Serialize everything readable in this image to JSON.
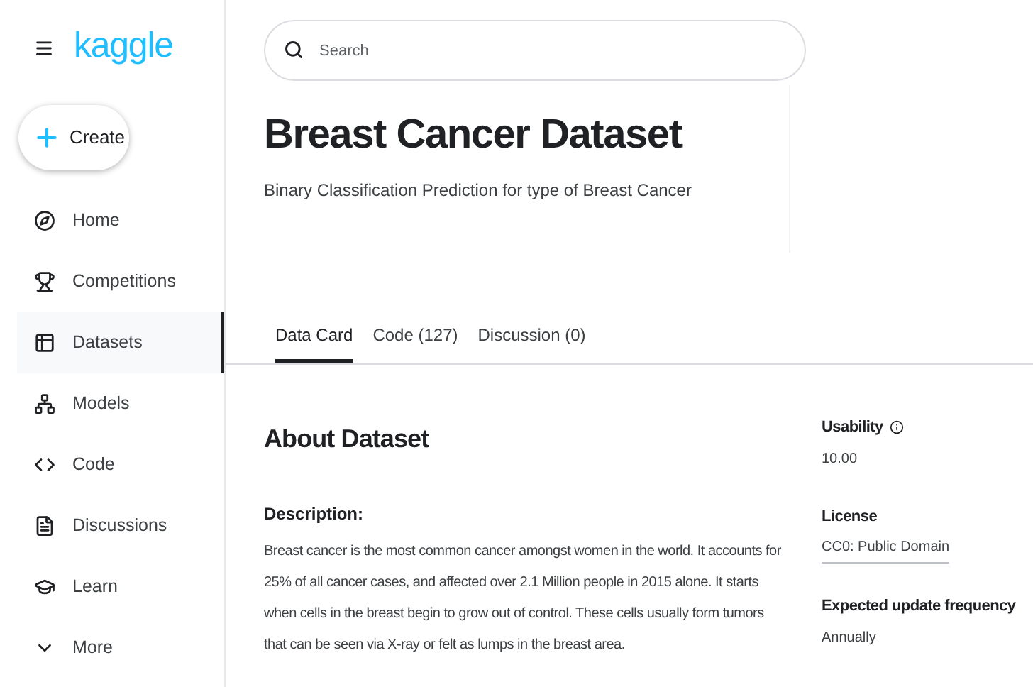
{
  "brand": {
    "logo": "kaggle"
  },
  "create_button": {
    "label": "Create"
  },
  "nav": [
    {
      "label": "Home",
      "selected": false
    },
    {
      "label": "Competitions",
      "selected": false
    },
    {
      "label": "Datasets",
      "selected": true
    },
    {
      "label": "Models",
      "selected": false
    },
    {
      "label": "Code",
      "selected": false
    },
    {
      "label": "Discussions",
      "selected": false
    },
    {
      "label": "Learn",
      "selected": false
    },
    {
      "label": "More",
      "selected": false
    }
  ],
  "search": {
    "placeholder": "Search"
  },
  "dataset": {
    "title": "Breast Cancer Dataset",
    "subtitle": "Binary Classification Prediction for type of Breast Cancer"
  },
  "tabs": [
    {
      "label": "Data Card",
      "selected": true
    },
    {
      "label": "Code (127)",
      "selected": false
    },
    {
      "label": "Discussion (0)",
      "selected": false
    }
  ],
  "about": {
    "heading": "About Dataset",
    "description_label": "Description:",
    "description": "Breast cancer is the most common cancer amongst women in the world. It accounts for 25% of all cancer cases, and affected over 2.1 Million people in 2015 alone. It starts when cells in the breast begin to grow out of control. These cells usually form tumors that can be seen via X-ray or felt as lumps in the breast area."
  },
  "meta": [
    {
      "kind": "info",
      "label": "Usability",
      "value": "10.00"
    },
    {
      "kind": "link",
      "label": "License",
      "value": "CC0: Public Domain"
    },
    {
      "kind": "plain",
      "label": "Expected update frequency",
      "value": "Annually"
    }
  ]
}
